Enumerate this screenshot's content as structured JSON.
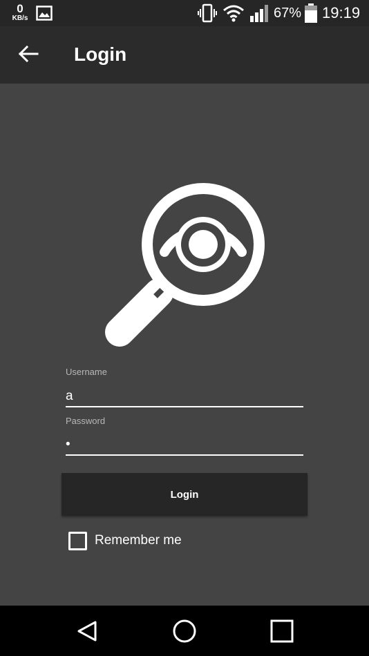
{
  "status_bar": {
    "net_speed_value": "0",
    "net_speed_unit": "KB/s",
    "battery_percent": "67%",
    "time": "19:19",
    "icons": [
      "image-icon",
      "vibrate-icon",
      "wifi-icon",
      "signal-icon",
      "battery-icon"
    ]
  },
  "app_bar": {
    "title": "Login",
    "back_icon": "arrow-left-icon"
  },
  "logo_icon": "magnifier-eye-icon",
  "form": {
    "username_label": "Username",
    "username_value": "a",
    "password_label": "Password",
    "password_value": "a",
    "login_label": "Login",
    "remember_label": "Remember me",
    "remember_checked": false
  },
  "nav_bar": {
    "icons": [
      "nav-back-icon",
      "nav-home-icon",
      "nav-recents-icon"
    ]
  },
  "colors": {
    "background": "#444444",
    "app_bar": "#2b2b2b",
    "status_bar": "#262626",
    "button": "#262626",
    "nav_bar": "#000000",
    "foreground": "#ffffff",
    "label": "#b8b8b8"
  }
}
